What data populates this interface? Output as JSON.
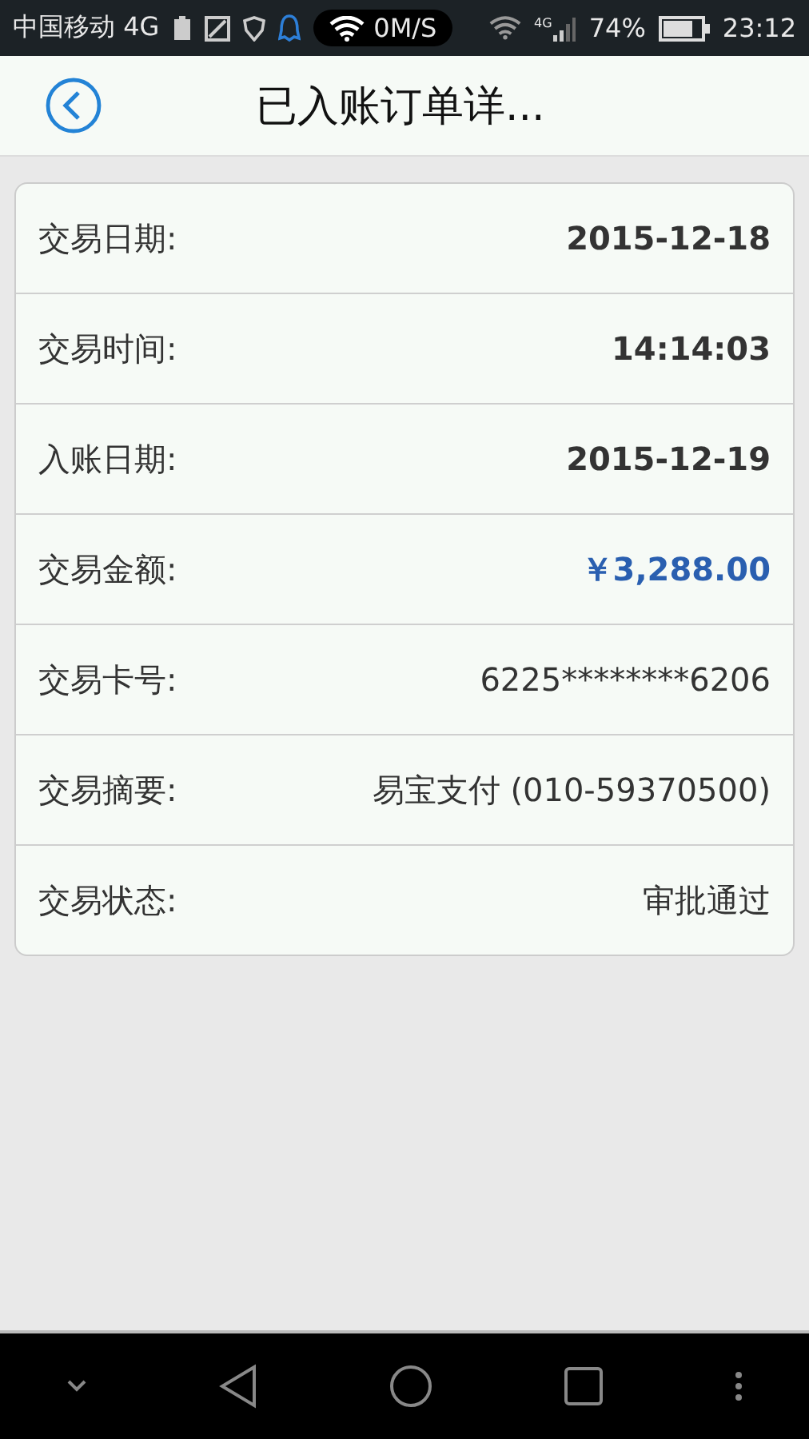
{
  "status_bar": {
    "carrier": "中国移动 4G",
    "speed": "0M/S",
    "signal_label": "4G",
    "battery": "74%",
    "time": "23:12"
  },
  "header": {
    "title": "已入账订单详..."
  },
  "details": [
    {
      "label": "交易日期:",
      "value": "2015-12-18",
      "kind": "bold"
    },
    {
      "label": "交易时间:",
      "value": "14:14:03",
      "kind": "bold"
    },
    {
      "label": "入账日期:",
      "value": "2015-12-19",
      "kind": "bold"
    },
    {
      "label": "交易金额:",
      "value": "￥3,288.00",
      "kind": "amount"
    },
    {
      "label": "交易卡号:",
      "value": "6225********6206",
      "kind": "plain"
    },
    {
      "label": "交易摘要:",
      "value": "易宝支付 (010-59370500)",
      "kind": "plain"
    },
    {
      "label": "交易状态:",
      "value": "审批通过",
      "kind": "plain"
    }
  ]
}
